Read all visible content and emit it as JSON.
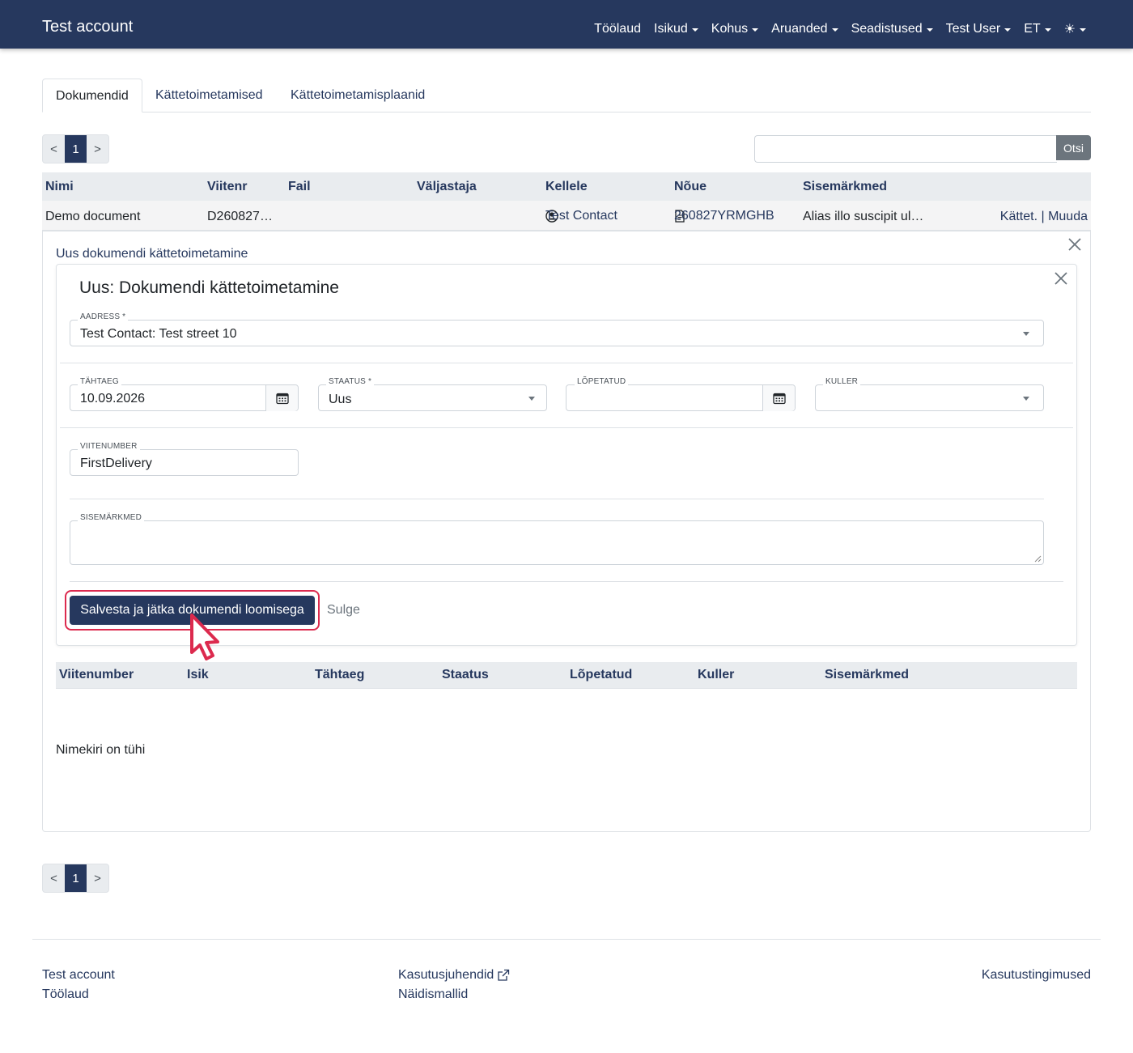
{
  "navbar": {
    "brand": "Test account",
    "items": [
      {
        "label": "Töölaud",
        "dropdown": false
      },
      {
        "label": "Isikud",
        "dropdown": true
      },
      {
        "label": "Kohus",
        "dropdown": true
      },
      {
        "label": "Aruanded",
        "dropdown": true
      },
      {
        "label": "Seadistused",
        "dropdown": true
      },
      {
        "label": "Test User",
        "dropdown": true
      },
      {
        "label": "ET",
        "dropdown": true
      }
    ],
    "theme_icon": "☀"
  },
  "tabs": [
    "Dokumendid",
    "Kättetoimetamised",
    "Kättetoimetamisplaanid"
  ],
  "pager": {
    "prev": "<",
    "current": "1",
    "next": ">"
  },
  "search": {
    "button": "Otsi",
    "value": ""
  },
  "doc_table": {
    "headers": [
      "Nimi",
      "Viitenr",
      "Fail",
      "Väljastaja",
      "Kellele",
      "Nõue",
      "Sisemärkmed"
    ],
    "row": {
      "nimi": "Demo document",
      "viitenr": "D260827…",
      "fail": "",
      "valjastaja": "",
      "kellele": "Test Contact",
      "noue": "260827YRMGHB",
      "sisemarkmed": "Alias illo suscipit ul…",
      "action_deliver": "Kättet.",
      "separator": "|",
      "action_edit": "Muuda"
    }
  },
  "panel": {
    "title": "Uus dokumendi kättetoimetamine",
    "form_title": "Uus: Dokumendi kättetoimetamine",
    "fields": {
      "aadress": {
        "label": "AADRESS *",
        "value": "Test Contact: Test street 10"
      },
      "tahtaeg": {
        "label": "TÄHTAEG",
        "value": "10.09.2026"
      },
      "staatus": {
        "label": "STAATUS *",
        "value": "Uus"
      },
      "lopetatud": {
        "label": "LÕPETATUD",
        "value": ""
      },
      "kuller": {
        "label": "KULLER",
        "value": ""
      },
      "viitenumber": {
        "label": "VIITENUMBER",
        "value": "FirstDelivery"
      },
      "sisemarkmed": {
        "label": "SISEMÄRKMED",
        "value": ""
      }
    },
    "save_button": "Salvesta ja jätka dokumendi loomisega",
    "close_button": "Sulge",
    "delivery_table": {
      "headers": [
        "Viitenumber",
        "Isik",
        "Tähtaeg",
        "Staatus",
        "Lõpetatud",
        "Kuller",
        "Sisemärkmed"
      ]
    },
    "empty_text": "Nimekiri on tühi"
  },
  "footer": {
    "left": [
      "Test account",
      "Töölaud"
    ],
    "middle": [
      "Kasutusjuhendid",
      "Näidismallid"
    ],
    "right": "Kasutustingimused"
  },
  "colors": {
    "primary": "#26385e",
    "highlight": "#dc2a4e",
    "secondary": "#6c757d"
  }
}
